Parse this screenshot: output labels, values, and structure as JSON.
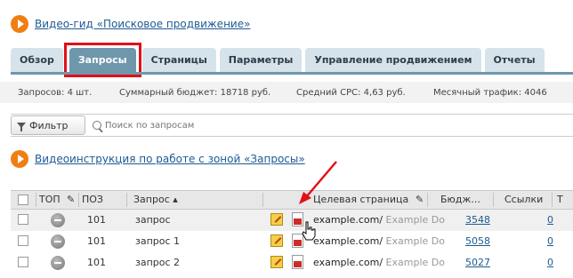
{
  "video_guide": {
    "label": "Видео-гид «Поисковое продвижение»"
  },
  "tabs": [
    {
      "label": "Обзор"
    },
    {
      "label": "Запросы"
    },
    {
      "label": "Страницы"
    },
    {
      "label": "Параметры"
    },
    {
      "label": "Управление продвижением"
    },
    {
      "label": "Отчеты"
    }
  ],
  "stats": {
    "queries": "Запросов: 4 шт.",
    "budget": "Суммарный бюджет: 18718 руб.",
    "cpc": "Средний CPC: 4,63 руб.",
    "traffic": "Месячный трафик: 4046"
  },
  "filter": {
    "label": "Фильтр",
    "search_placeholder": "Поиск по запросам"
  },
  "video_instruction": {
    "label": "Видеоинструкция по работе с зоной «Запросы»"
  },
  "table": {
    "headers": {
      "top": "ТОП",
      "pos": "ПОЗ",
      "query": "Запрос ▴",
      "target": "Целевая страница",
      "budget": "Бюдж...",
      "links": "Ссылки",
      "t": "Т"
    },
    "rows": [
      {
        "pos": "101",
        "query": "запрос",
        "domain": "example.com/",
        "title": "Example Do",
        "budget": "3548",
        "links": "0"
      },
      {
        "pos": "101",
        "query": "запрос 1",
        "domain": "example.com/",
        "title": "Example Do",
        "budget": "5058",
        "links": "0"
      },
      {
        "pos": "101",
        "query": "запрос 2",
        "domain": "example.com/",
        "title": "Example Do",
        "budget": "5027",
        "links": "0"
      }
    ]
  },
  "colors": {
    "accent_orange": "#f07f13",
    "tab_active": "#6f97ab",
    "tab_inactive": "#d6e3ea",
    "highlight_red": "#e1101a",
    "link_blue": "#1e5a92"
  }
}
